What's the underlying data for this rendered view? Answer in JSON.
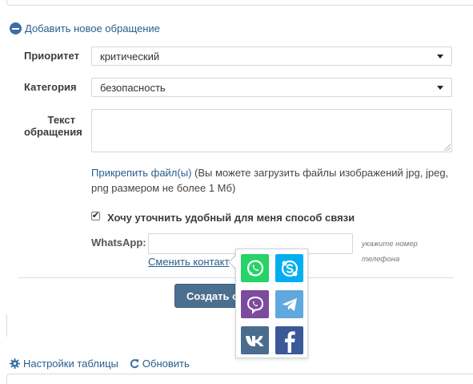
{
  "form": {
    "toggle_label": "Добавить новое обращение",
    "priority": {
      "label": "Приоритет",
      "value": "критический"
    },
    "category": {
      "label": "Категория",
      "value": "безопасность"
    },
    "text": {
      "label_line1": "Текст",
      "label_line2": "обращения",
      "value": ""
    },
    "attach": {
      "link_label": "Прикрепить файл(ы)",
      "note": " (Вы можете загрузить файлы изображений jpg, jpeg, png размером не более 1 Мб)"
    },
    "clarify_contact": {
      "label": "Хочу уточнить удобный для меня способ связи",
      "checked": true,
      "mark": "✔"
    },
    "whatsapp": {
      "label": "WhatsApp:",
      "value": "",
      "hint": "укажите номер телефона"
    },
    "change_contact_label": "Сменить контакт",
    "submit_label": "Создать обращение"
  },
  "messenger_popup": {
    "options": [
      {
        "name": "whatsapp",
        "icon": "whatsapp-icon",
        "color": "#25d366"
      },
      {
        "name": "skype",
        "icon": "skype-icon",
        "color": "#00aff0"
      },
      {
        "name": "viber",
        "icon": "viber-icon",
        "color": "#7d4b9e"
      },
      {
        "name": "telegram",
        "icon": "telegram-icon",
        "color": "#61a8de"
      },
      {
        "name": "vk",
        "icon": "vk-icon",
        "color": "#4a6c8f"
      },
      {
        "name": "facebook",
        "icon": "facebook-icon",
        "color": "#3b5998"
      }
    ]
  },
  "footer": {
    "settings_label": "Настройки таблицы",
    "refresh_label": "Обновить"
  }
}
